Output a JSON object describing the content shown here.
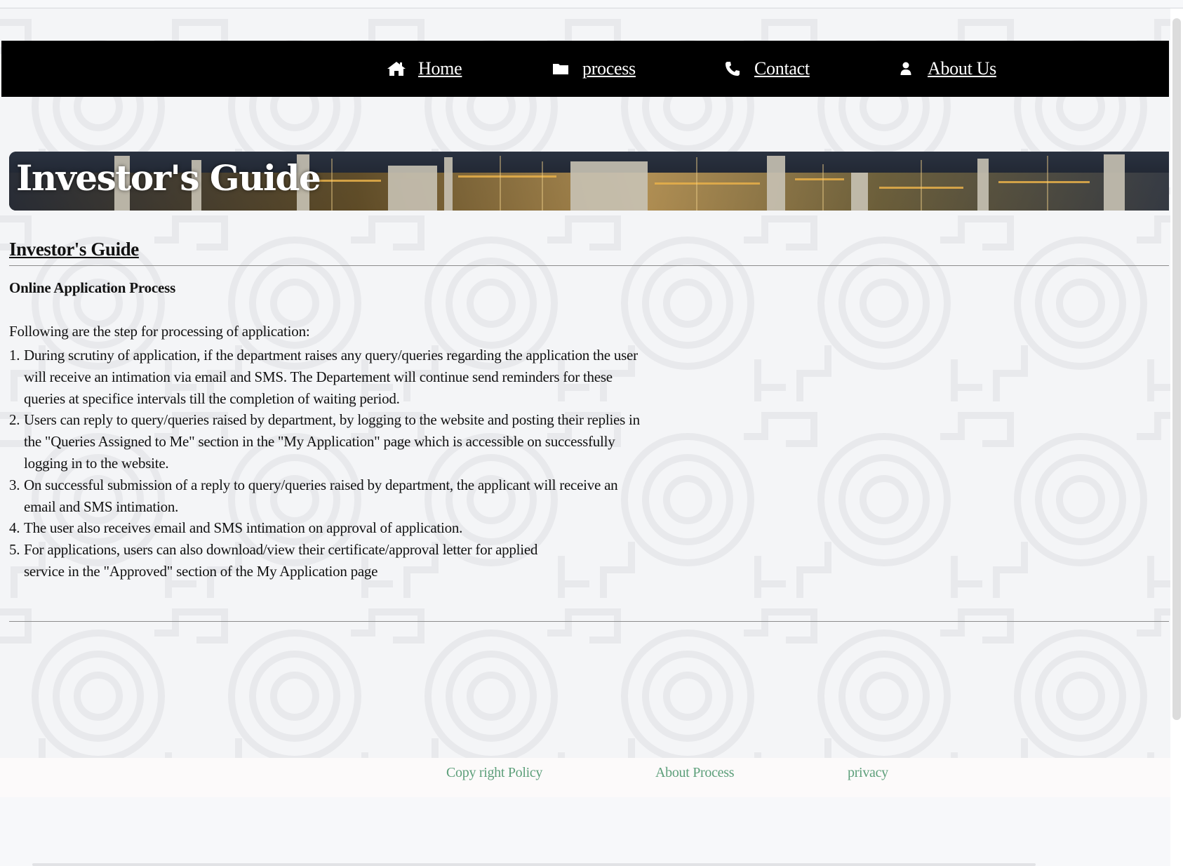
{
  "nav": {
    "items": [
      {
        "label": "Home",
        "icon": "home-icon"
      },
      {
        "label": "process",
        "icon": "folder-icon"
      },
      {
        "label": "Contact",
        "icon": "phone-icon"
      },
      {
        "label": "About Us",
        "icon": "user-icon"
      }
    ],
    "background": "#000000",
    "text_color": "#ffffff"
  },
  "banner": {
    "title": "Investor's Guide"
  },
  "content": {
    "heading": "Investor's Guide",
    "subheading": "Online Application Process",
    "intro": "Following are the step for processing of application:",
    "steps": [
      {
        "num": "1.",
        "text": "During scrutiny of application, if the department raises any query/queries regarding the application the user\nwill receive an intimation via email and SMS. The Departement will continue send reminders for these\nqueries at specifice intervals till the completion of waiting period."
      },
      {
        "num": "2.",
        "text": "Users can reply to query/queries raised by department, by logging to the website and posting their replies in\nthe \"Queries Assigned to Me\" section in the \"My Application\" page which is accessible on successfully\nlogging  in to the website."
      },
      {
        "num": "3.",
        "text": "On successful submission of a reply to query/queries raised by department, the applicant will receive an\n email and SMS  intimation."
      },
      {
        "num": "4.",
        "text": "The user also receives email and SMS intimation on approval of application."
      },
      {
        "num": "5.",
        "text": "For applications, users can also download/view their certificate/approval letter for applied\nservice in the \"Approved\" section of the My Application page"
      }
    ]
  },
  "footer": {
    "links": [
      {
        "label": "Copy right Policy"
      },
      {
        "label": "About Process"
      },
      {
        "label": "privacy"
      }
    ],
    "link_color": "#5d9f7a"
  }
}
